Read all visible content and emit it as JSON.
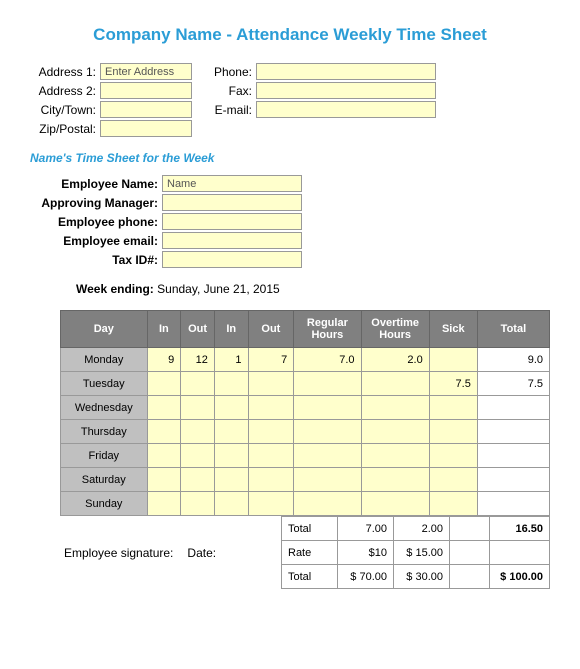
{
  "title": "Company Name - Attendance Weekly Time Sheet",
  "address": {
    "label1": "Address 1:",
    "value1": "Enter Address",
    "label2": "Address 2:",
    "value2": "",
    "label3": "City/Town:",
    "value3": "",
    "label4": "Zip/Postal:",
    "value4": ""
  },
  "contact": {
    "label1": "Phone:",
    "value1": "",
    "label2": "Fax:",
    "value2": "",
    "label3": "E-mail:",
    "value3": ""
  },
  "subhead": "Name's Time Sheet for the Week",
  "employee": {
    "name_label": "Employee Name:",
    "name_value": "Name",
    "mgr_label": "Approving Manager:",
    "mgr_value": "",
    "phone_label": "Employee phone:",
    "phone_value": "",
    "email_label": "Employee email:",
    "email_value": "",
    "tax_label": "Tax ID#:",
    "tax_value": ""
  },
  "week_ending_label": "Week ending:",
  "week_ending_value": "Sunday, June 21, 2015",
  "headers": {
    "day": "Day",
    "in1": "In",
    "out1": "Out",
    "in2": "In",
    "out2": "Out",
    "reg": "Regular Hours",
    "ot": "Overtime Hours",
    "sick": "Sick",
    "total": "Total"
  },
  "rows": [
    {
      "day": "Monday",
      "in1": "9",
      "out1": "12",
      "in2": "1",
      "out2": "7",
      "reg": "7.0",
      "ot": "2.0",
      "sick": "",
      "total": "9.0"
    },
    {
      "day": "Tuesday",
      "in1": "",
      "out1": "",
      "in2": "",
      "out2": "",
      "reg": "",
      "ot": "",
      "sick": "7.5",
      "total": "7.5"
    },
    {
      "day": "Wednesday",
      "in1": "",
      "out1": "",
      "in2": "",
      "out2": "",
      "reg": "",
      "ot": "",
      "sick": "",
      "total": ""
    },
    {
      "day": "Thursday",
      "in1": "",
      "out1": "",
      "in2": "",
      "out2": "",
      "reg": "",
      "ot": "",
      "sick": "",
      "total": ""
    },
    {
      "day": "Friday",
      "in1": "",
      "out1": "",
      "in2": "",
      "out2": "",
      "reg": "",
      "ot": "",
      "sick": "",
      "total": ""
    },
    {
      "day": "Saturday",
      "in1": "",
      "out1": "",
      "in2": "",
      "out2": "",
      "reg": "",
      "ot": "",
      "sick": "",
      "total": ""
    },
    {
      "day": "Sunday",
      "in1": "",
      "out1": "",
      "in2": "",
      "out2": "",
      "reg": "",
      "ot": "",
      "sick": "",
      "total": ""
    }
  ],
  "totals": {
    "row1_label": "Total",
    "row1_reg": "7.00",
    "row1_ot": "2.00",
    "row1_sick": "",
    "row1_total": "16.50",
    "row2_label": "Rate",
    "row2_reg": "$10",
    "row2_ot": "$    15.00",
    "row2_sick": "",
    "row2_total": "",
    "row3_label": "Total",
    "row3_reg": "$  70.00",
    "row3_ot": "$    30.00",
    "row3_sick": "",
    "row3_total": "$  100.00"
  },
  "signature": {
    "emp": "Employee signature:",
    "date": "Date:"
  }
}
